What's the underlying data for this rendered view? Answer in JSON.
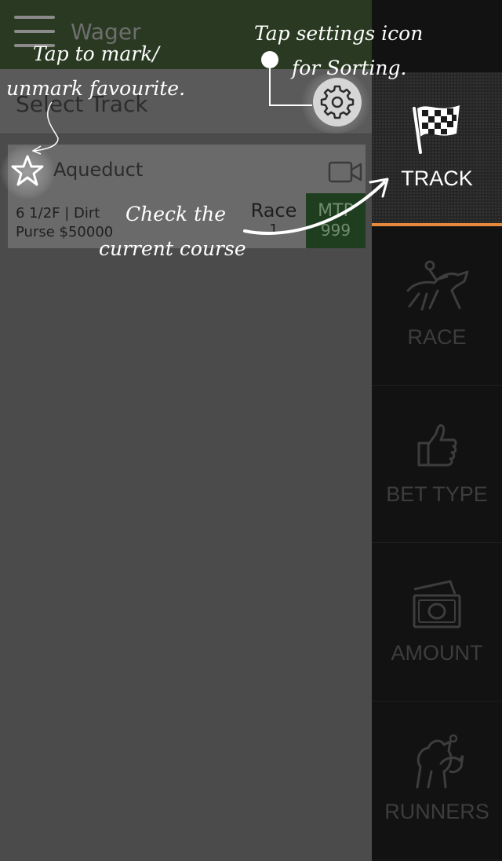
{
  "header": {
    "title": "Wager",
    "menu_icon": "hamburger-menu-icon",
    "wallet_icon": "dollar-icon"
  },
  "select_track": {
    "title": "Select Track",
    "settings_icon": "gear-icon"
  },
  "track": {
    "name": "Aqueduct",
    "favourite_icon": "star-icon",
    "video_icon": "video-camera-icon",
    "distance": "6 1/2F | Dirt",
    "purse": "Purse $50000",
    "race_label": "Race",
    "race_number": "1",
    "mtp_label": "MTP",
    "mtp_value": "999"
  },
  "sidebar": {
    "items": [
      {
        "label": "TRACK",
        "icon": "checkered-flag-icon",
        "active": true
      },
      {
        "label": "RACE",
        "icon": "horse-jockey-icon",
        "active": false
      },
      {
        "label": "BET TYPE",
        "icon": "thumbs-up-icon",
        "active": false
      },
      {
        "label": "AMOUNT",
        "icon": "money-icon",
        "active": false
      },
      {
        "label": "RUNNERS",
        "icon": "horses-racing-icon",
        "active": false
      }
    ],
    "active_color": "#e58a3c"
  },
  "hints": {
    "favourite_line1": "Tap to mark/",
    "favourite_line2": "unmark favourite.",
    "settings_line1": "Tap settings icon",
    "settings_line2": "for Sorting.",
    "course_line1": "Check the",
    "course_line2": "current course"
  }
}
